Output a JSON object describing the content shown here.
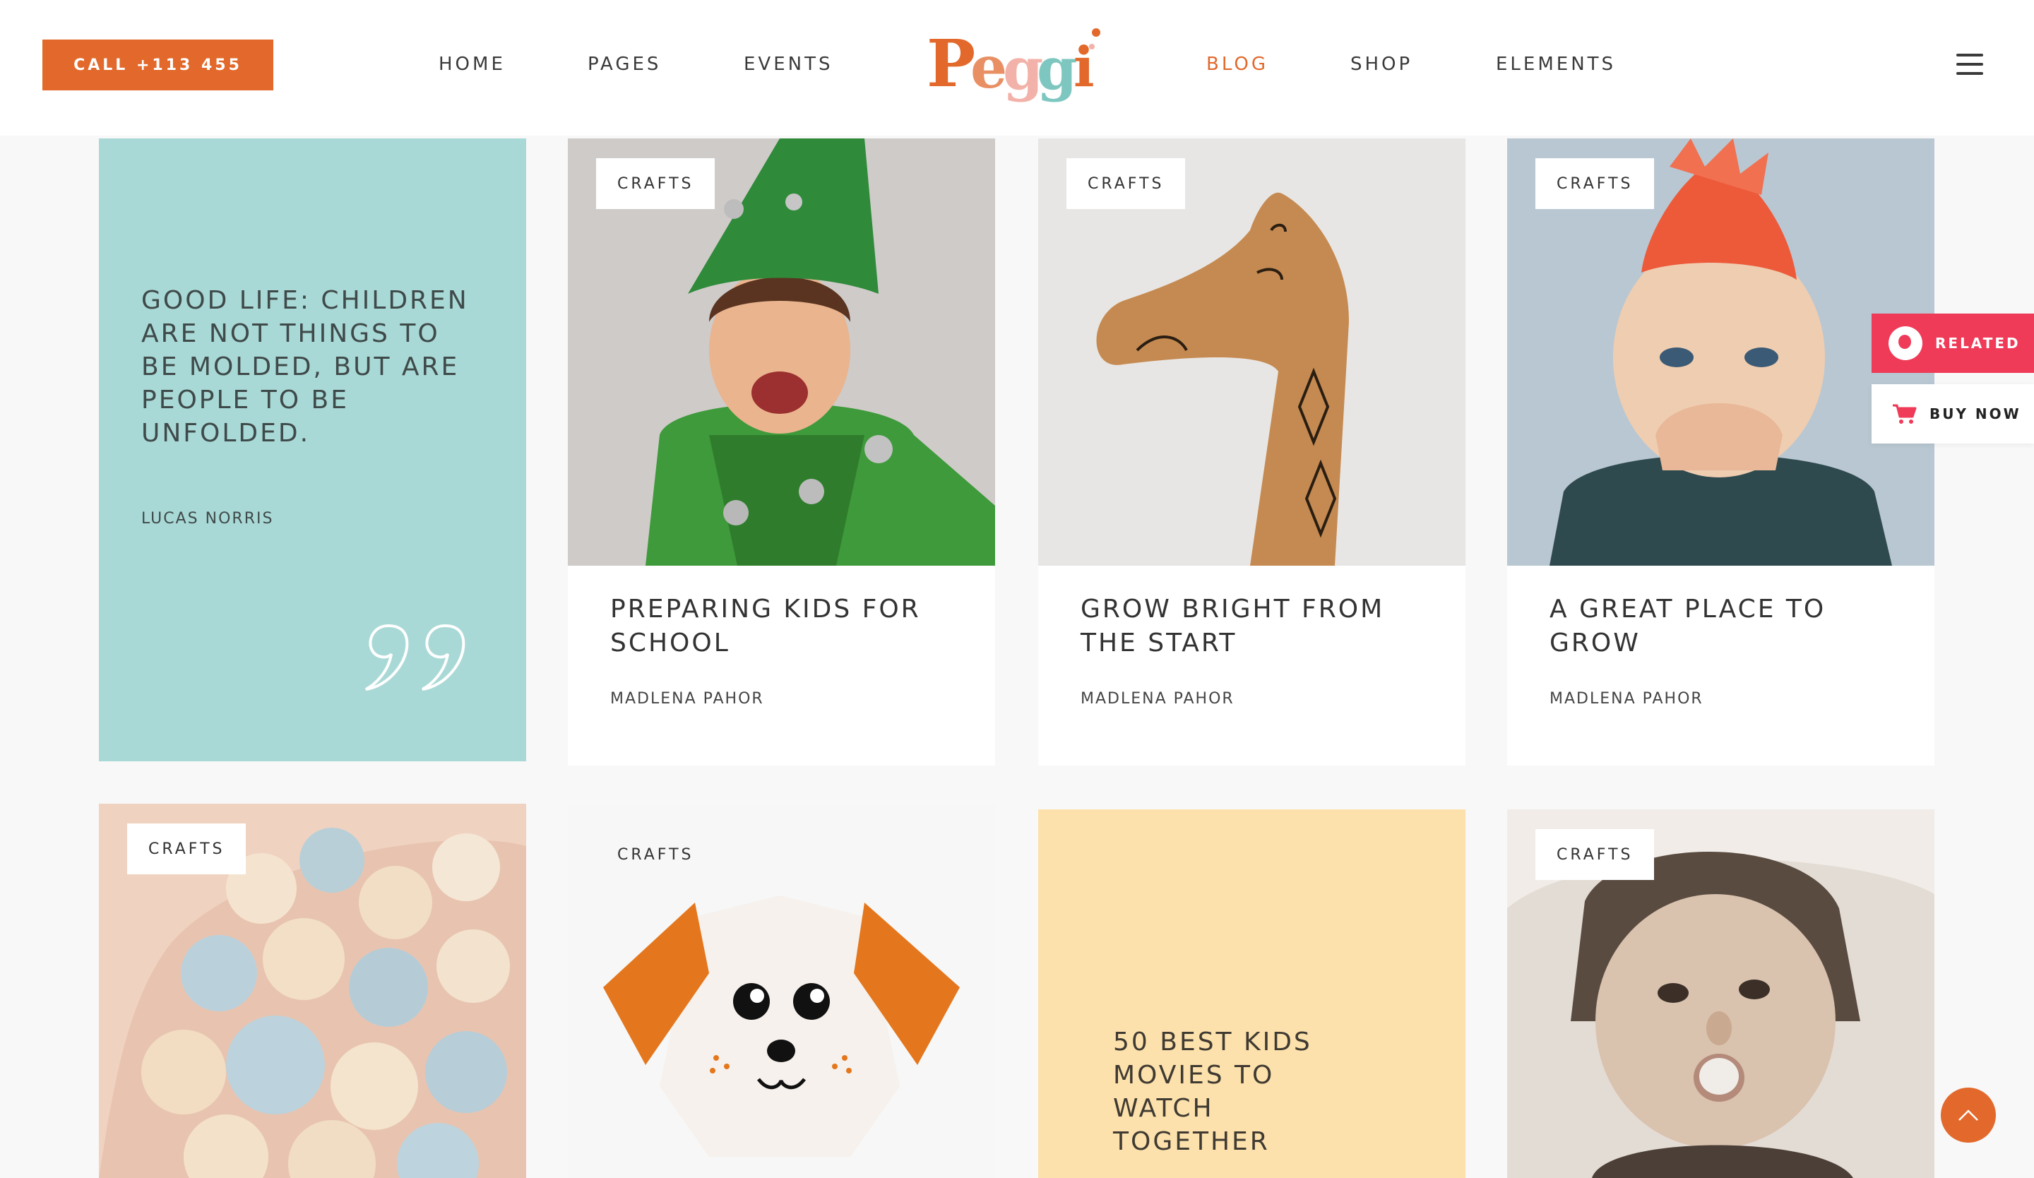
{
  "header": {
    "call_label": "CALL +113 455",
    "nav_left": [
      "HOME",
      "PAGES",
      "EVENTS"
    ],
    "logo_text": "Peggi",
    "nav_right": [
      "BLOG",
      "SHOP",
      "ELEMENTS"
    ],
    "active_nav": "BLOG"
  },
  "colors": {
    "accent": "#e2692b",
    "quote_bg": "#a9d9d6",
    "yellow_bg": "#fde1ac",
    "related": "#ef3a58"
  },
  "quote_card": {
    "text": "GOOD LIFE: CHILDREN ARE NOT THINGS TO BE MOLDED, BUT ARE PEOPLE TO BE UNFOLDED.",
    "author": "LUCAS NORRIS"
  },
  "posts": [
    {
      "tag": "CRAFTS",
      "title": "PREPARING KIDS FOR SCHOOL",
      "author": "MADLENA PAHOR",
      "image": "boy-in-green-elf-costume"
    },
    {
      "tag": "CRAFTS",
      "title": "GROW BRIGHT FROM THE START",
      "author": "MADLENA PAHOR",
      "image": "wooden-giraffe-toy"
    },
    {
      "tag": "CRAFTS",
      "title": "A GREAT PLACE TO GROW",
      "author": "MADLENA PAHOR",
      "image": "boy-with-red-mohawk"
    },
    {
      "tag": "CRAFTS",
      "image": "pastel-ball-pit"
    },
    {
      "tag": "CRAFTS",
      "image": "origami-dog-face"
    },
    {
      "tag": "CRAFTS",
      "image": "girl-blowing-bubble"
    }
  ],
  "yellow_card": {
    "text": "50 BEST KIDS MOVIES TO WATCH TOGETHER"
  },
  "side": {
    "related_label": "RELATED",
    "buy_label": "BUY NOW"
  }
}
